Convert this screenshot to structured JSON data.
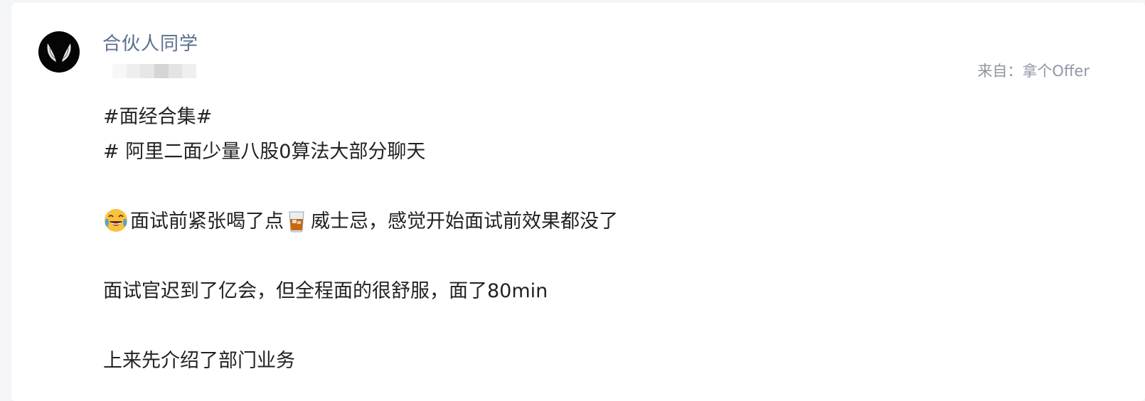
{
  "post": {
    "author": {
      "name": "合伙人同学"
    },
    "source": {
      "prefix": "来自：",
      "app": "拿个Offer"
    },
    "lines": [
      {
        "text": "#面经合集#"
      },
      {
        "text": "# 阿里二面少量八股0算法大部分聊天"
      },
      {
        "text": ""
      },
      {
        "emoji_start": "laughing-crying-emoji",
        "part1": "面试前紧张喝了点",
        "emoji_mid": "whisky-glass-emoji",
        "part2": "威士忌，感觉开始面试前效果都没了"
      },
      {
        "text": ""
      },
      {
        "text": "面试官迟到了亿会，但全程面的很舒服，面了80min"
      },
      {
        "text": ""
      },
      {
        "text": "上来先介绍了部门业务"
      }
    ]
  },
  "colors": {
    "author_name": "#5b6f8c",
    "body_text": "#222222",
    "meta_text": "#8f96a3",
    "card_bg": "#ffffff",
    "page_bg": "#f4f5f7"
  }
}
